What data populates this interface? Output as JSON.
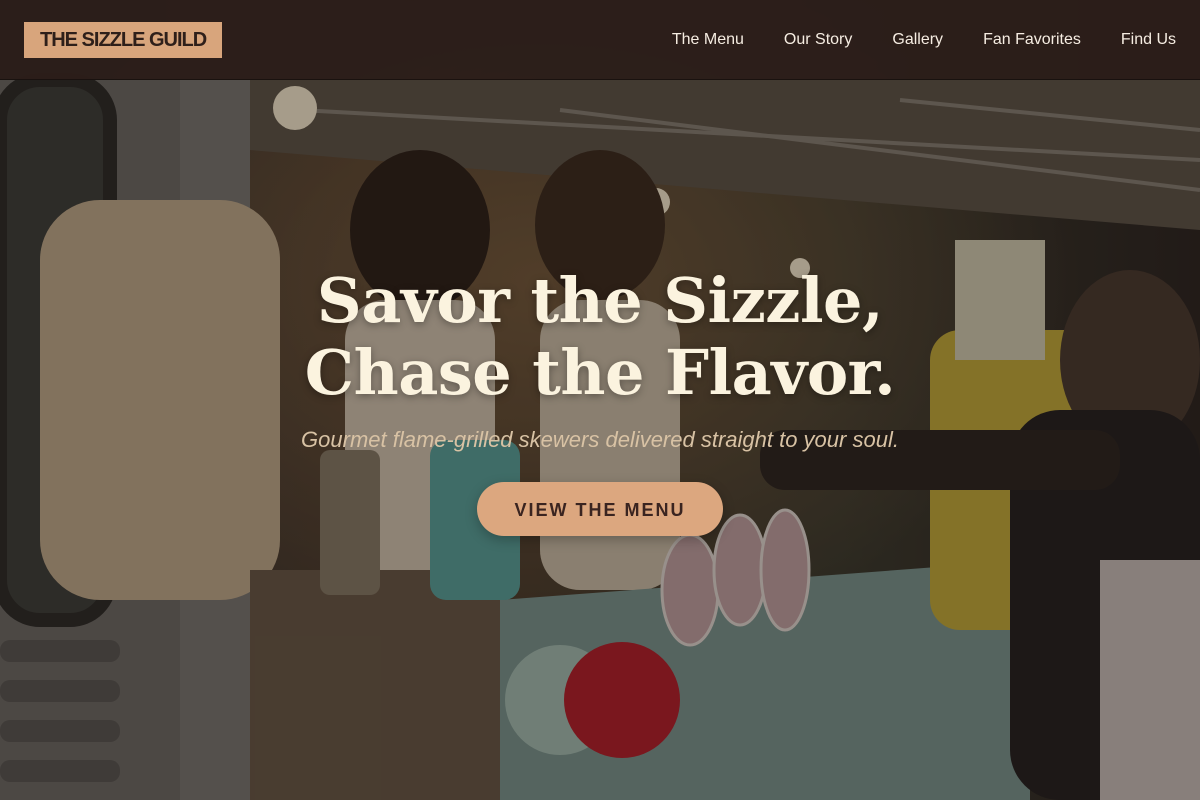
{
  "header": {
    "logo_text": "THE SIZZLE GUILD",
    "nav": [
      {
        "label": "The Menu"
      },
      {
        "label": "Our Story"
      },
      {
        "label": "Gallery"
      },
      {
        "label": "Fan Favorites"
      },
      {
        "label": "Find Us"
      }
    ]
  },
  "hero": {
    "title_line1": "Savor the Sizzle,",
    "title_line2": "Chase the Flavor.",
    "subtitle": "Gourmet flame-grilled skewers delivered straight to your soul.",
    "cta_label": "VIEW THE MENU",
    "background_image": "food-truck-vendors-photo"
  },
  "colors": {
    "header_bg": "#2c1e1a",
    "accent": "#d8a57c",
    "title_text": "#fbf3df",
    "subtitle_text": "#d8c2a4"
  }
}
